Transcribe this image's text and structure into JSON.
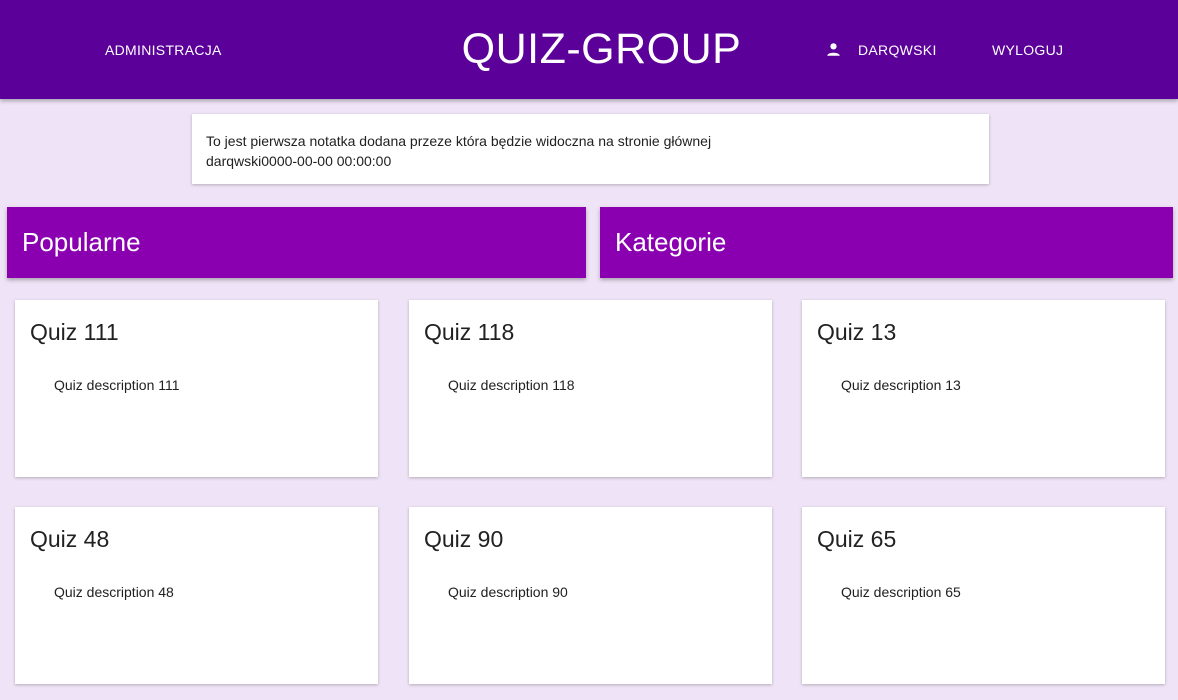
{
  "header": {
    "admin_label": "ADMINISTRACJA",
    "title": "QUIZ-GROUP",
    "user_label": "DARQWSKI",
    "logout_label": "WYLOGUJ"
  },
  "note": {
    "text": "To jest pierwsza notatka dodana przeze która będzie widoczna na stronie głównej",
    "meta": "darqwski0000-00-00 00:00:00"
  },
  "sections": {
    "popular": "Popularne",
    "categories": "Kategorie"
  },
  "quizzes": [
    {
      "title": "Quiz 111",
      "description": "Quiz description 111"
    },
    {
      "title": "Quiz 118",
      "description": "Quiz description 118"
    },
    {
      "title": "Quiz 13",
      "description": "Quiz description 13"
    },
    {
      "title": "Quiz 48",
      "description": "Quiz description 48"
    },
    {
      "title": "Quiz 90",
      "description": "Quiz description 90"
    },
    {
      "title": "Quiz 65",
      "description": "Quiz description 65"
    }
  ],
  "colors": {
    "header_bg": "#5b0099",
    "section_bg": "#8a00b0",
    "page_bg": "#efe4f7"
  },
  "icons": {
    "user": "person-icon"
  }
}
